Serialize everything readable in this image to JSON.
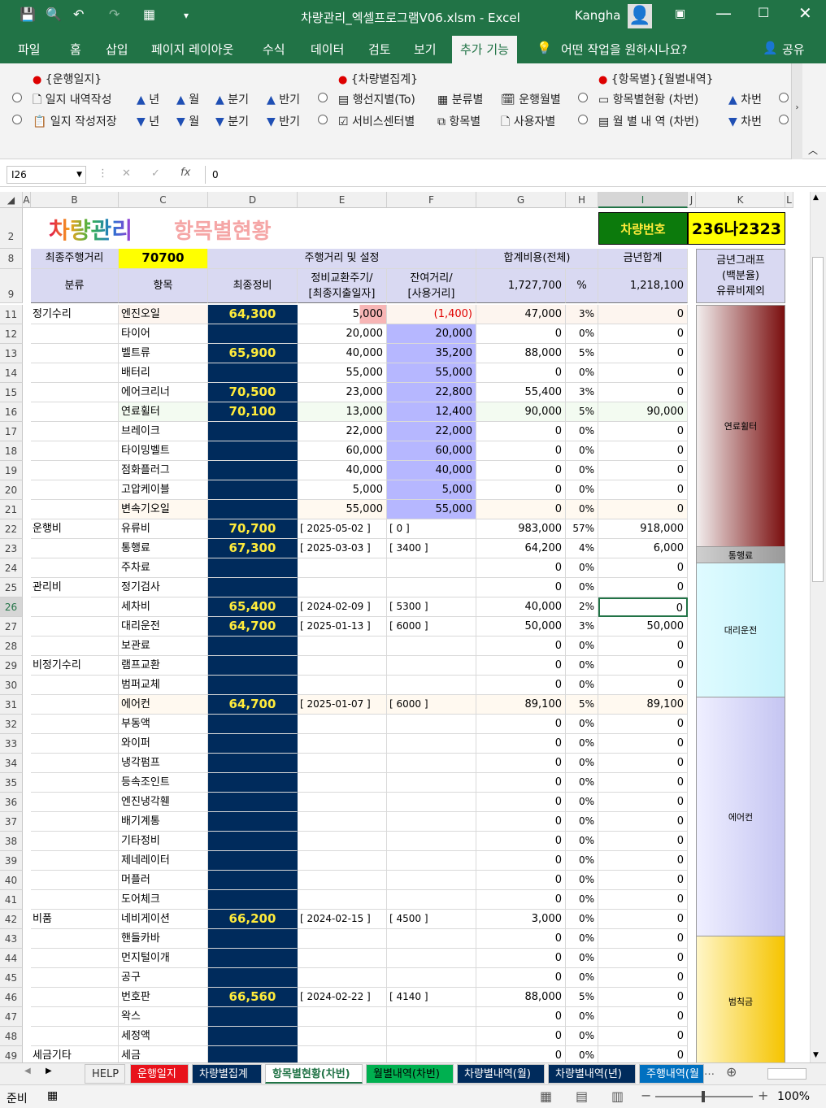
{
  "window": {
    "title": "차량관리_엑셀프로그램V06.xlsm  -  Excel",
    "user": "Kangha"
  },
  "ribbon_tabs": [
    "파일",
    "홈",
    "삽입",
    "페이지 레이아웃",
    "수식",
    "데이터",
    "검토",
    "보기",
    "추가 기능"
  ],
  "tell_me": "어떤 작업을 원하시나요?",
  "share": "공유",
  "addin": {
    "group1_title": "{운행일지}",
    "journal_write": "일지 내역작성",
    "journal_save": "일지 작성저장",
    "year": "년",
    "month": "월",
    "quarter": "분기",
    "half": "반기",
    "group2_title": "{차량별집계}",
    "by_region": "행선지별(To)",
    "by_category": "분류별",
    "by_monthly_run": "운행월별",
    "by_service_center": "서비스센터별",
    "by_item": "항목별",
    "by_user": "사용자별",
    "group3_title": "{항목별}{월별내역}",
    "item_status": "항목별현황 (차번)",
    "monthly_detail": "월 별 내 역 (차번)",
    "car_no": "차번"
  },
  "formula_bar": {
    "name_box": "I26",
    "value": "0"
  },
  "columns": [
    "A",
    "B",
    "C",
    "D",
    "E",
    "F",
    "G",
    "H",
    "I",
    "J",
    "K",
    "L"
  ],
  "sheet": {
    "logo": "차량관리",
    "heading": "항목별현황",
    "car_label": "차량번호",
    "car_number": "236나2323",
    "last_km_label": "최종주행거리",
    "last_km": "70700",
    "mileage_setting": "주행거리 및 설정",
    "total_cost_label": "합계비용(전체)",
    "year_total_label": "금년합계",
    "graph_label": "금년그래프\n(백분율)\n유류비제외",
    "h_category": "분류",
    "h_item": "항목",
    "h_last": "최종정비",
    "h_cycle": "정비교환주기/\n[최종지출일자]",
    "h_remain": "잔여거리/\n[사용거리]",
    "total_cost": "1,727,700",
    "h_pct": "%",
    "year_total": "1,218,100"
  },
  "rows": [
    {
      "r": "11",
      "cat": "정기수리",
      "item": "엔진오일",
      "last": "64,300",
      "cycle": "5,000",
      "remain": "(1,400)",
      "cost": "47,000",
      "pct": "3%",
      "year": "0",
      "cycle_hl": true,
      "remain_red": true
    },
    {
      "r": "12",
      "cat": "",
      "item": "타이어",
      "last": "",
      "cycle": "20,000",
      "remain": "20,000",
      "cost": "0",
      "pct": "0%",
      "year": "0",
      "blue": true
    },
    {
      "r": "13",
      "cat": "",
      "item": "벨트류",
      "last": "65,900",
      "cycle": "40,000",
      "remain": "35,200",
      "cost": "88,000",
      "pct": "5%",
      "year": "0",
      "blue": true
    },
    {
      "r": "14",
      "cat": "",
      "item": "배터리",
      "last": "",
      "cycle": "55,000",
      "remain": "55,000",
      "cost": "0",
      "pct": "0%",
      "year": "0",
      "blue": true
    },
    {
      "r": "15",
      "cat": "",
      "item": "에어크리너",
      "last": "70,500",
      "cycle": "23,000",
      "remain": "22,800",
      "cost": "55,400",
      "pct": "3%",
      "year": "0",
      "blue": true
    },
    {
      "r": "16",
      "cat": "",
      "item": "연료휠터",
      "last": "70,100",
      "cycle": "13,000",
      "remain": "12,400",
      "cost": "90,000",
      "pct": "5%",
      "year": "90,000",
      "blue": true
    },
    {
      "r": "17",
      "cat": "",
      "item": "브레이크",
      "last": "",
      "cycle": "22,000",
      "remain": "22,000",
      "cost": "0",
      "pct": "0%",
      "year": "0",
      "blue": true
    },
    {
      "r": "18",
      "cat": "",
      "item": "타이밍벨트",
      "last": "",
      "cycle": "60,000",
      "remain": "60,000",
      "cost": "0",
      "pct": "0%",
      "year": "0",
      "blue": true
    },
    {
      "r": "19",
      "cat": "",
      "item": "점화플러그",
      "last": "",
      "cycle": "40,000",
      "remain": "40,000",
      "cost": "0",
      "pct": "0%",
      "year": "0",
      "blue": true
    },
    {
      "r": "20",
      "cat": "",
      "item": "고압케이블",
      "last": "",
      "cycle": "5,000",
      "remain": "5,000",
      "cost": "0",
      "pct": "0%",
      "year": "0",
      "blue": true
    },
    {
      "r": "21",
      "cat": "",
      "item": "변속기오일",
      "last": "",
      "cycle": "55,000",
      "remain": "55,000",
      "cost": "0",
      "pct": "0%",
      "year": "0",
      "blue": true
    },
    {
      "r": "22",
      "cat": "운행비",
      "item": "유류비",
      "last": "70,700",
      "cycle": "[ 2025-05-02 ]",
      "remain": "[ 0 ]",
      "cost": "983,000",
      "pct": "57%",
      "year": "918,000"
    },
    {
      "r": "23",
      "cat": "",
      "item": "통행료",
      "last": "67,300",
      "cycle": "[ 2025-03-03 ]",
      "remain": "[ 3400 ]",
      "cost": "64,200",
      "pct": "4%",
      "year": "6,000"
    },
    {
      "r": "24",
      "cat": "",
      "item": "주차료",
      "last": "",
      "cycle": "",
      "remain": "",
      "cost": "0",
      "pct": "0%",
      "year": "0"
    },
    {
      "r": "25",
      "cat": "관리비",
      "item": "정기검사",
      "last": "",
      "cycle": "",
      "remain": "",
      "cost": "0",
      "pct": "0%",
      "year": "0"
    },
    {
      "r": "26",
      "cat": "",
      "item": "세차비",
      "last": "65,400",
      "cycle": "[ 2024-02-09 ]",
      "remain": "[ 5300 ]",
      "cost": "40,000",
      "pct": "2%",
      "year": "0",
      "sel": true
    },
    {
      "r": "27",
      "cat": "",
      "item": "대리운전",
      "last": "64,700",
      "cycle": "[ 2025-01-13 ]",
      "remain": "[ 6000 ]",
      "cost": "50,000",
      "pct": "3%",
      "year": "50,000"
    },
    {
      "r": "28",
      "cat": "",
      "item": "보관료",
      "last": "",
      "cycle": "",
      "remain": "",
      "cost": "0",
      "pct": "0%",
      "year": "0"
    },
    {
      "r": "29",
      "cat": "비정기수리",
      "item": "램프교환",
      "last": "",
      "cycle": "",
      "remain": "",
      "cost": "0",
      "pct": "0%",
      "year": "0"
    },
    {
      "r": "30",
      "cat": "",
      "item": "범퍼교체",
      "last": "",
      "cycle": "",
      "remain": "",
      "cost": "0",
      "pct": "0%",
      "year": "0"
    },
    {
      "r": "31",
      "cat": "",
      "item": "에어컨",
      "last": "64,700",
      "cycle": "[ 2025-01-07 ]",
      "remain": "[ 6000 ]",
      "cost": "89,100",
      "pct": "5%",
      "year": "89,100"
    },
    {
      "r": "32",
      "cat": "",
      "item": "부동액",
      "last": "",
      "cycle": "",
      "remain": "",
      "cost": "0",
      "pct": "0%",
      "year": "0"
    },
    {
      "r": "33",
      "cat": "",
      "item": "와이퍼",
      "last": "",
      "cycle": "",
      "remain": "",
      "cost": "0",
      "pct": "0%",
      "year": "0"
    },
    {
      "r": "34",
      "cat": "",
      "item": "냉각펌프",
      "last": "",
      "cycle": "",
      "remain": "",
      "cost": "0",
      "pct": "0%",
      "year": "0"
    },
    {
      "r": "35",
      "cat": "",
      "item": "등속조인트",
      "last": "",
      "cycle": "",
      "remain": "",
      "cost": "0",
      "pct": "0%",
      "year": "0"
    },
    {
      "r": "36",
      "cat": "",
      "item": "엔진냉각휀",
      "last": "",
      "cycle": "",
      "remain": "",
      "cost": "0",
      "pct": "0%",
      "year": "0"
    },
    {
      "r": "37",
      "cat": "",
      "item": "배기계통",
      "last": "",
      "cycle": "",
      "remain": "",
      "cost": "0",
      "pct": "0%",
      "year": "0"
    },
    {
      "r": "38",
      "cat": "",
      "item": "기타정비",
      "last": "",
      "cycle": "",
      "remain": "",
      "cost": "0",
      "pct": "0%",
      "year": "0"
    },
    {
      "r": "39",
      "cat": "",
      "item": "제네레이터",
      "last": "",
      "cycle": "",
      "remain": "",
      "cost": "0",
      "pct": "0%",
      "year": "0"
    },
    {
      "r": "40",
      "cat": "",
      "item": "머플러",
      "last": "",
      "cycle": "",
      "remain": "",
      "cost": "0",
      "pct": "0%",
      "year": "0"
    },
    {
      "r": "41",
      "cat": "",
      "item": "도어체크",
      "last": "",
      "cycle": "",
      "remain": "",
      "cost": "0",
      "pct": "0%",
      "year": "0"
    },
    {
      "r": "42",
      "cat": "비품",
      "item": "네비게이션",
      "last": "66,200",
      "cycle": "[ 2024-02-15 ]",
      "remain": "[ 4500 ]",
      "cost": "3,000",
      "pct": "0%",
      "year": "0"
    },
    {
      "r": "43",
      "cat": "",
      "item": "핸들카바",
      "last": "",
      "cycle": "",
      "remain": "",
      "cost": "0",
      "pct": "0%",
      "year": "0"
    },
    {
      "r": "44",
      "cat": "",
      "item": "먼지털이개",
      "last": "",
      "cycle": "",
      "remain": "",
      "cost": "0",
      "pct": "0%",
      "year": "0"
    },
    {
      "r": "45",
      "cat": "",
      "item": "공구",
      "last": "",
      "cycle": "",
      "remain": "",
      "cost": "0",
      "pct": "0%",
      "year": "0"
    },
    {
      "r": "46",
      "cat": "",
      "item": "번호판",
      "last": "66,560",
      "cycle": "[ 2024-02-22 ]",
      "remain": "[ 4140 ]",
      "cost": "88,000",
      "pct": "5%",
      "year": "0"
    },
    {
      "r": "47",
      "cat": "",
      "item": "왁스",
      "last": "",
      "cycle": "",
      "remain": "",
      "cost": "0",
      "pct": "0%",
      "year": "0"
    },
    {
      "r": "48",
      "cat": "",
      "item": "세정액",
      "last": "",
      "cycle": "",
      "remain": "",
      "cost": "0",
      "pct": "0%",
      "year": "0"
    },
    {
      "r": "49",
      "cat": "세금기타",
      "item": "세금",
      "last": "",
      "cycle": "",
      "remain": "",
      "cost": "0",
      "pct": "0%",
      "year": "0"
    }
  ],
  "graph_segments": [
    {
      "label": "연료휠터",
      "value": 90000,
      "color_top": "#f2eeee",
      "color_bottom": "#7a0e0e"
    },
    {
      "label": "통행료",
      "value": 6000,
      "color_top": "#cfcfcf",
      "color_bottom": "#9a9a9a"
    },
    {
      "label": "대리운전",
      "value": 50000,
      "color_top": "#dffbff",
      "color_bottom": "#c5f3fb"
    },
    {
      "label": "에어컨",
      "value": 89100,
      "color_top": "#efefff",
      "color_bottom": "#c5c5f2"
    },
    {
      "label": "범칙금",
      "value": 0,
      "color_top": "#fff6c8",
      "color_bottom": "#f5c400"
    }
  ],
  "sheet_tabs": [
    {
      "label": "HELP",
      "bg": "#f0f0f0",
      "fg": "#333"
    },
    {
      "label": "운행일지",
      "bg": "#e8121b",
      "fg": "#fff"
    },
    {
      "label": "차량별집계",
      "bg": "#002b5c",
      "fg": "#fff"
    },
    {
      "label": "항목별현황(차번)",
      "bg": "#ffffff",
      "fg": "#217346"
    },
    {
      "label": "월별내역(차번)",
      "bg": "#00b050",
      "fg": "#000"
    },
    {
      "label": "차량별내역(월)",
      "bg": "#002b5c",
      "fg": "#fff"
    },
    {
      "label": "차량별내역(년)",
      "bg": "#002b5c",
      "fg": "#fff"
    },
    {
      "label": "주행내역(월",
      "bg": "#0070c0",
      "fg": "#fff"
    }
  ],
  "status": {
    "ready": "준비",
    "zoom": "100%"
  }
}
